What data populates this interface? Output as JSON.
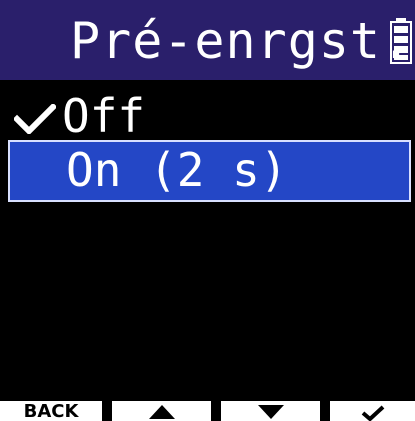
{
  "header": {
    "title": "Pré-enrgst.",
    "battery_icon": "battery-icon"
  },
  "menu": {
    "items": [
      {
        "label": "Off",
        "checked": true,
        "selected": false
      },
      {
        "label": "On (2 s)",
        "checked": false,
        "selected": true
      }
    ]
  },
  "footer": {
    "back_label": "BACK",
    "up_icon": "triangle-up-icon",
    "down_icon": "triangle-down-icon",
    "enter_icon": "checkmark-icon"
  },
  "colors": {
    "title_bar": "#2a1f6b",
    "selection": "#2447c6",
    "background": "#000000",
    "text": "#ffffff"
  }
}
